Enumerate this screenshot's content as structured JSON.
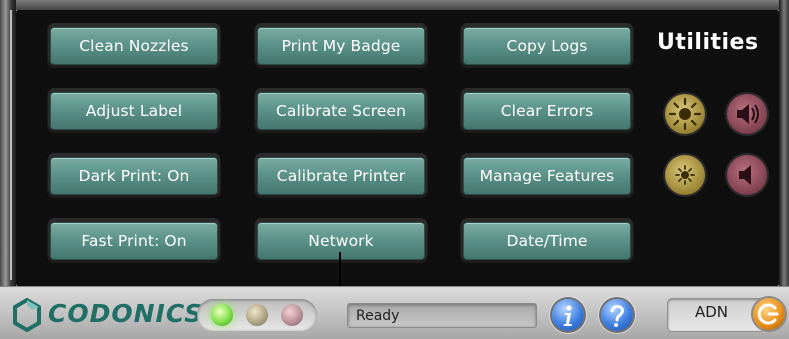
{
  "title": "Utilities",
  "buttons": {
    "clean_nozzles": "Clean Nozzles",
    "print_my_badge": "Print My Badge",
    "copy_logs": "Copy Logs",
    "adjust_label": "Adjust Label",
    "calibrate_screen": "Calibrate Screen",
    "clear_errors": "Clear Errors",
    "dark_print": "Dark Print: On",
    "calibrate_printer": "Calibrate Printer",
    "manage_features": "Manage Features",
    "fast_print": "Fast Print: On",
    "network": "Network",
    "date_time": "Date/Time"
  },
  "controls": {
    "brightness_up_icon": "sun-large-icon",
    "volume_up_icon": "speaker-loud-icon",
    "brightness_down_icon": "sun-small-icon",
    "volume_down_icon": "speaker-quiet-icon"
  },
  "footer": {
    "brand": "CODONICS",
    "status": "Ready",
    "user": "ADN",
    "info_icon": "info-icon",
    "help_icon": "help-icon",
    "logout_icon": "logout-icon"
  },
  "colors": {
    "button_teal": "#5c938a",
    "screen_bg": "#0f0f10",
    "brand_teal": "#1f6f67",
    "led_green": "#7ee04a"
  }
}
